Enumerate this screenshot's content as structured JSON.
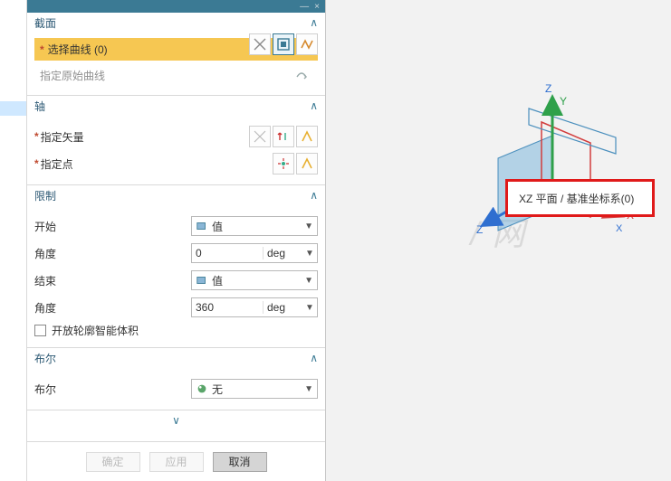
{
  "header_icons": {
    "min": "—",
    "close": "×"
  },
  "sections": {
    "section_cross": {
      "title": "截面",
      "select_curve_label": "选择曲线 (0)",
      "orig_curve_label": "指定原始曲线"
    },
    "section_axis": {
      "title": "轴",
      "vector_label": "指定矢量",
      "point_label": "指定点"
    },
    "section_limit": {
      "title": "限制",
      "start_label": "开始",
      "end_label": "结束",
      "angle_label": "角度",
      "value_option": "值",
      "start_angle": "0",
      "end_angle": "360",
      "unit": "deg",
      "open_profile_label": "开放轮廓智能体积"
    },
    "section_bool": {
      "title": "布尔",
      "bool_label": "布尔",
      "none_option": "无"
    }
  },
  "footer": {
    "ok": "确定",
    "apply": "应用",
    "cancel": "取消"
  },
  "viewport": {
    "axis_x": "X",
    "axis_y": "Y",
    "axis_z": "Z",
    "callout": "XZ 平面 / 基准坐标系(0)",
    "watermark": "/ 网"
  }
}
